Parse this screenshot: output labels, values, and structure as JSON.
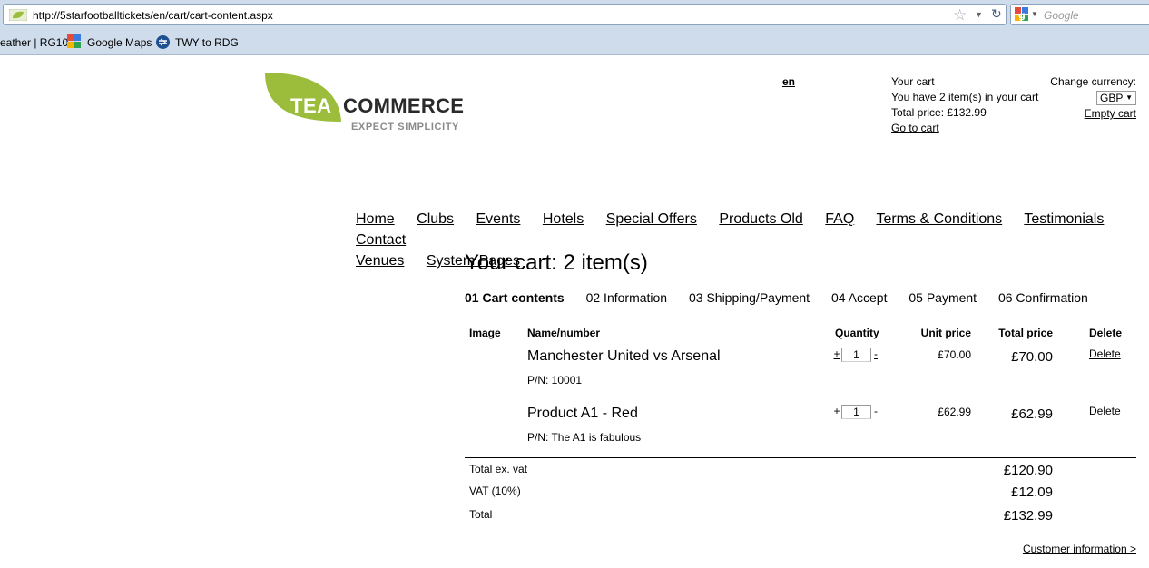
{
  "browser": {
    "url": "http://5starfootballtickets/en/cart/cart-content.aspx",
    "search_placeholder": "Google",
    "bookmarks": [
      {
        "label": "eather | RG10"
      },
      {
        "label": "Google Maps"
      },
      {
        "label": "TWY to RDG"
      }
    ]
  },
  "logo": {
    "word1": "TEA",
    "word2": "COMMERCE",
    "tagline": "EXPECT SIMPLICITY",
    "leaf_color": "#9bbd3b"
  },
  "header": {
    "language": "en",
    "cart": {
      "title": "Your cart",
      "items_text": "You have 2 item(s) in your cart",
      "total_text": "Total price: £132.99",
      "goto_link": "Go to cart"
    },
    "currency": {
      "label": "Change currency:",
      "selected": "GBP",
      "empty_cart_link": "Empty cart"
    }
  },
  "nav": {
    "items": [
      "Home",
      "Clubs",
      "Events",
      "Hotels",
      "Special Offers",
      "Products Old",
      "FAQ",
      "Terms & Conditions",
      "Testimonials",
      "Contact",
      "Venues",
      "System Pages"
    ]
  },
  "page_title": "Your cart: 2 item(s)",
  "steps": [
    {
      "label": "01 Cart contents",
      "active": true
    },
    {
      "label": "02 Information"
    },
    {
      "label": "03 Shipping/Payment"
    },
    {
      "label": "04 Accept"
    },
    {
      "label": "05 Payment"
    },
    {
      "label": "06 Confirmation"
    }
  ],
  "table": {
    "headers": {
      "image": "Image",
      "name": "Name/number",
      "quantity": "Quantity",
      "unit_price": "Unit price",
      "total_price": "Total price",
      "delete": "Delete"
    },
    "rows": [
      {
        "name": "Manchester United vs Arsenal",
        "pn": "P/N: 10001",
        "plus": "+",
        "qty": "1",
        "minus": "-",
        "unit_price": "£70.00",
        "total_price": "£70.00",
        "delete": "Delete"
      },
      {
        "name": "Product A1 - Red",
        "pn": "P/N: The A1 is fabulous",
        "plus": "+",
        "qty": "1",
        "minus": "-",
        "unit_price": "£62.99",
        "total_price": "£62.99",
        "delete": "Delete"
      }
    ],
    "summary": {
      "ex_vat_label": "Total ex. vat",
      "ex_vat_value": "£120.90",
      "vat_label": "VAT (10%)",
      "vat_value": "£12.09",
      "total_label": "Total",
      "total_value": "£132.99"
    }
  },
  "customer_info_link": "Customer information >"
}
